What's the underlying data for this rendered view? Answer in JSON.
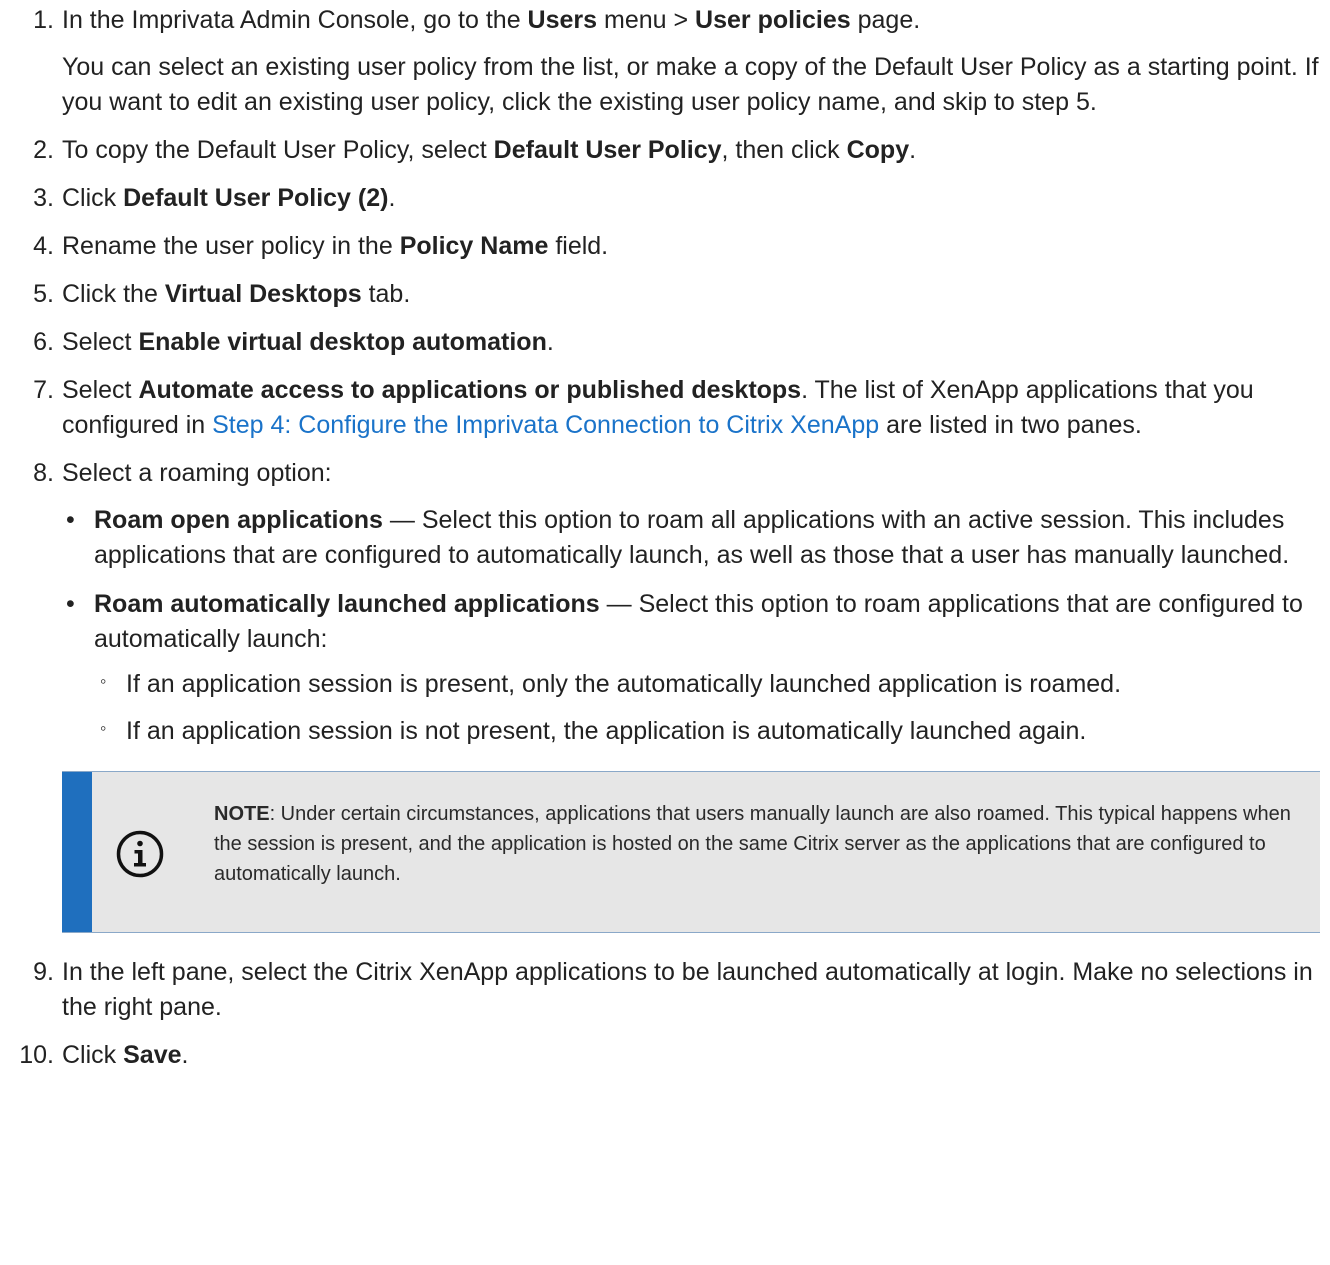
{
  "steps": [
    {
      "num": "1.",
      "parts": [
        "In the Imprivata Admin Console, go to the ",
        "Users",
        " menu > ",
        "User policies",
        " page."
      ],
      "para": "You can select an existing user policy from the list, or make a copy of the Default User Policy as a starting point. If you want to edit an existing user policy, click the existing user policy name, and skip to step 5."
    },
    {
      "num": "2.",
      "parts": [
        "To copy the Default User Policy, select ",
        "Default User Policy",
        ", then click ",
        "Copy",
        "."
      ]
    },
    {
      "num": "3.",
      "parts": [
        "Click ",
        "Default User Policy (2)",
        "."
      ]
    },
    {
      "num": "4.",
      "parts": [
        "Rename the user policy in the ",
        "Policy Name",
        " field."
      ]
    },
    {
      "num": "5.",
      "parts": [
        "Click the ",
        "Virtual Desktops",
        " tab."
      ]
    },
    {
      "num": "6.",
      "parts": [
        "Select ",
        "Enable virtual desktop automation",
        "."
      ]
    },
    {
      "num": "7.",
      "parts": [
        "Select ",
        "Automate access to applications or published desktops",
        ". The list of XenApp applications that you configured in ",
        "Step 4: Configure the Imprivata Connection to Citrix XenApp",
        " are listed in two panes."
      ]
    },
    {
      "num": "8.",
      "parts": [
        "Select a roaming option:"
      ]
    },
    {
      "num": "9.",
      "parts": [
        "In the left pane, select the Citrix XenApp applications to be launched automatically at login. Make no selections in the right pane."
      ]
    },
    {
      "num": "10.",
      "parts": [
        "Click ",
        "Save",
        "."
      ]
    }
  ],
  "roaming": [
    {
      "title": "Roam open applications",
      "text": " — Select this option to roam all applications with an active session. This includes applications that are configured to automatically launch, as well as those that a user has manually launched."
    },
    {
      "title": "Roam automatically launched applications",
      "text": " — Select this option to roam applications that are configured to automatically launch:",
      "subs": [
        "If an application session is present, only the automatically launched application is roamed.",
        "If an application session is not present, the application is automatically launched again."
      ]
    }
  ],
  "note": {
    "label": "NOTE",
    "text": ": Under certain circumstances, applications that users manually launch are also roamed. This typical happens when the session is present, and the application is hosted on the same Citrix server as the applications that are configured to automatically launch.",
    "icon": "info-icon",
    "accent": "#1f6fbe",
    "background": "#e6e6e6"
  },
  "link_color": "#1a73c9"
}
